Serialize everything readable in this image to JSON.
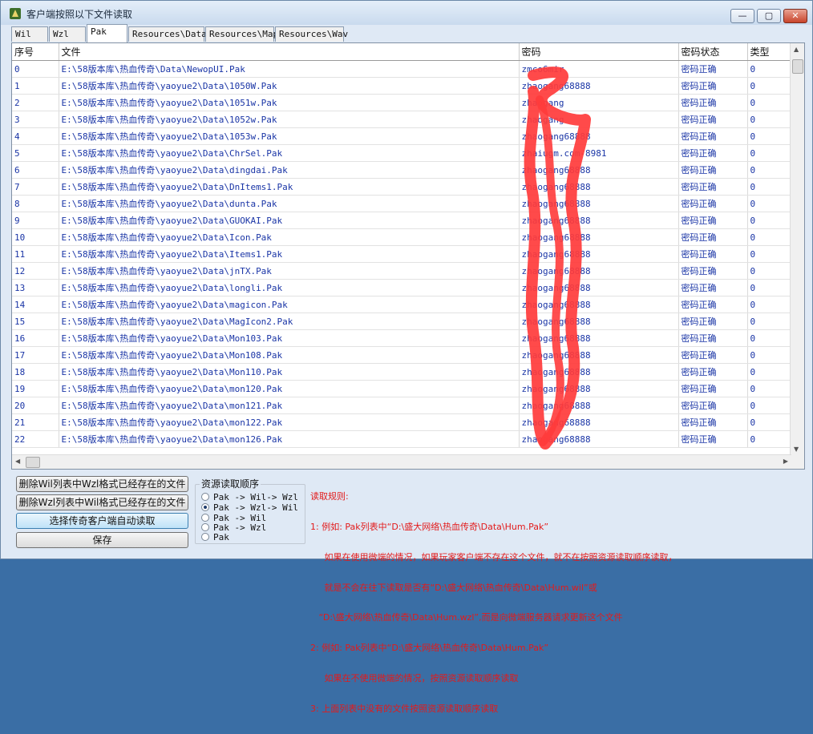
{
  "window": {
    "title": "客户端按照以下文件读取",
    "controls": {
      "minimize": "—",
      "maximize": "▢",
      "close": "✕"
    }
  },
  "tabs": [
    {
      "label": "Wil",
      "active": false
    },
    {
      "label": "Wzl",
      "active": false
    },
    {
      "label": "Pak",
      "active": true
    },
    {
      "label": "Resources\\Data",
      "active": false
    },
    {
      "label": "Resources\\Map",
      "active": false
    },
    {
      "label": "Resources\\Wav",
      "active": false
    }
  ],
  "table": {
    "columns": [
      "序号",
      "文件",
      "密码",
      "密码状态",
      "类型"
    ],
    "rows": [
      [
        "0",
        "E:\\58版本库\\热血传奇\\Data\\NewopUI.Pak",
        "zmco6mir",
        "密码正确",
        "0"
      ],
      [
        "1",
        "E:\\58版本库\\热血传奇\\yaoyue2\\Data\\1050W.Pak",
        "zhaogang68888",
        "密码正确",
        "0"
      ],
      [
        "2",
        "E:\\58版本库\\热血传奇\\yaoyue2\\Data\\1051w.Pak",
        "zhaogang",
        "密码正确",
        "0"
      ],
      [
        "3",
        "E:\\58版本库\\热血传奇\\yaoyue2\\Data\\1052w.Pak",
        "zhaogang",
        "密码正确",
        "0"
      ],
      [
        "4",
        "E:\\58版本库\\热血传奇\\yaoyue2\\Data\\1053w.Pak",
        "zhaogang68888",
        "密码正确",
        "0"
      ],
      [
        "5",
        "E:\\58版本库\\热血传奇\\yaoyue2\\Data\\ChrSel.Pak",
        "zhaiugm.com-8981",
        "密码正确",
        "0"
      ],
      [
        "6",
        "E:\\58版本库\\热血传奇\\yaoyue2\\Data\\dingdai.Pak",
        "zhaogang68888",
        "密码正确",
        "0"
      ],
      [
        "7",
        "E:\\58版本库\\热血传奇\\yaoyue2\\Data\\DnItems1.Pak",
        "zhaogang68888",
        "密码正确",
        "0"
      ],
      [
        "8",
        "E:\\58版本库\\热血传奇\\yaoyue2\\Data\\dunta.Pak",
        "zhaogang68888",
        "密码正确",
        "0"
      ],
      [
        "9",
        "E:\\58版本库\\热血传奇\\yaoyue2\\Data\\GUOKAI.Pak",
        "zhaogang68888",
        "密码正确",
        "0"
      ],
      [
        "10",
        "E:\\58版本库\\热血传奇\\yaoyue2\\Data\\Icon.Pak",
        "zhaogang68888",
        "密码正确",
        "0"
      ],
      [
        "11",
        "E:\\58版本库\\热血传奇\\yaoyue2\\Data\\Items1.Pak",
        "zhaogang68888",
        "密码正确",
        "0"
      ],
      [
        "12",
        "E:\\58版本库\\热血传奇\\yaoyue2\\Data\\jnTX.Pak",
        "zhaogang68888",
        "密码正确",
        "0"
      ],
      [
        "13",
        "E:\\58版本库\\热血传奇\\yaoyue2\\Data\\longli.Pak",
        "zhaogang68888",
        "密码正确",
        "0"
      ],
      [
        "14",
        "E:\\58版本库\\热血传奇\\yaoyue2\\Data\\magicon.Pak",
        "zhaogang68888",
        "密码正确",
        "0"
      ],
      [
        "15",
        "E:\\58版本库\\热血传奇\\yaoyue2\\Data\\MagIcon2.Pak",
        "zhaogang68888",
        "密码正确",
        "0"
      ],
      [
        "16",
        "E:\\58版本库\\热血传奇\\yaoyue2\\Data\\Mon103.Pak",
        "zhaogang68888",
        "密码正确",
        "0"
      ],
      [
        "17",
        "E:\\58版本库\\热血传奇\\yaoyue2\\Data\\Mon108.Pak",
        "zhaogang68888",
        "密码正确",
        "0"
      ],
      [
        "18",
        "E:\\58版本库\\热血传奇\\yaoyue2\\Data\\Mon110.Pak",
        "zhaogang68888",
        "密码正确",
        "0"
      ],
      [
        "19",
        "E:\\58版本库\\热血传奇\\yaoyue2\\Data\\mon120.Pak",
        "zhaogang68888",
        "密码正确",
        "0"
      ],
      [
        "20",
        "E:\\58版本库\\热血传奇\\yaoyue2\\Data\\mon121.Pak",
        "zhaogang68888",
        "密码正确",
        "0"
      ],
      [
        "21",
        "E:\\58版本库\\热血传奇\\yaoyue2\\Data\\mon122.Pak",
        "zhaogang68888",
        "密码正确",
        "0"
      ],
      [
        "22",
        "E:\\58版本库\\热血传奇\\yaoyue2\\Data\\mon126.Pak",
        "zhaogang68888",
        "密码正确",
        "0"
      ]
    ]
  },
  "buttons": {
    "delete_wil": "删除Wil列表中Wzl格式已经存在的文件",
    "delete_wzl": "删除Wzl列表中Wil格式已经存在的文件",
    "select_auto": "选择传奇客户端自动读取",
    "save": "保存"
  },
  "resource_order": {
    "title": "资源读取顺序",
    "options": [
      {
        "label": "Pak -> Wil-> Wzl",
        "checked": false
      },
      {
        "label": "Pak -> Wzl-> Wil",
        "checked": true
      },
      {
        "label": "Pak -> Wil",
        "checked": false
      },
      {
        "label": "Pak -> Wzl",
        "checked": false
      },
      {
        "label": "Pak",
        "checked": false
      }
    ]
  },
  "rules": [
    "读取规则:",
    "1: 例如: Pak列表中“D:\\盛大网络\\热血传奇\\Data\\Hum.Pak”",
    "     如果在使用微端的情况，如果玩家客户端不存在这个文件，就不在按照资源读取顺序读取，",
    "     就是不会在往下读取是否有“D:\\盛大网络\\热血传奇\\Data\\Hum.wil”或",
    "   “D:\\盛大网络\\热血传奇\\Data\\Hum.wzl”,而是向微端服务器请求更新这个文件",
    "2: 例如: Pak列表中“D:\\盛大网络\\热血传奇\\Data\\Hum.Pak”",
    "     如果在不使用微端的情况，按照资源读取顺序读取",
    "3: 上面列表中没有的文件按照资源读取顺序读取"
  ],
  "colors": {
    "rules_text": "#e31a1a",
    "cell_text": "#1a35a6",
    "annotation_scribble": "#ff3b3b"
  }
}
